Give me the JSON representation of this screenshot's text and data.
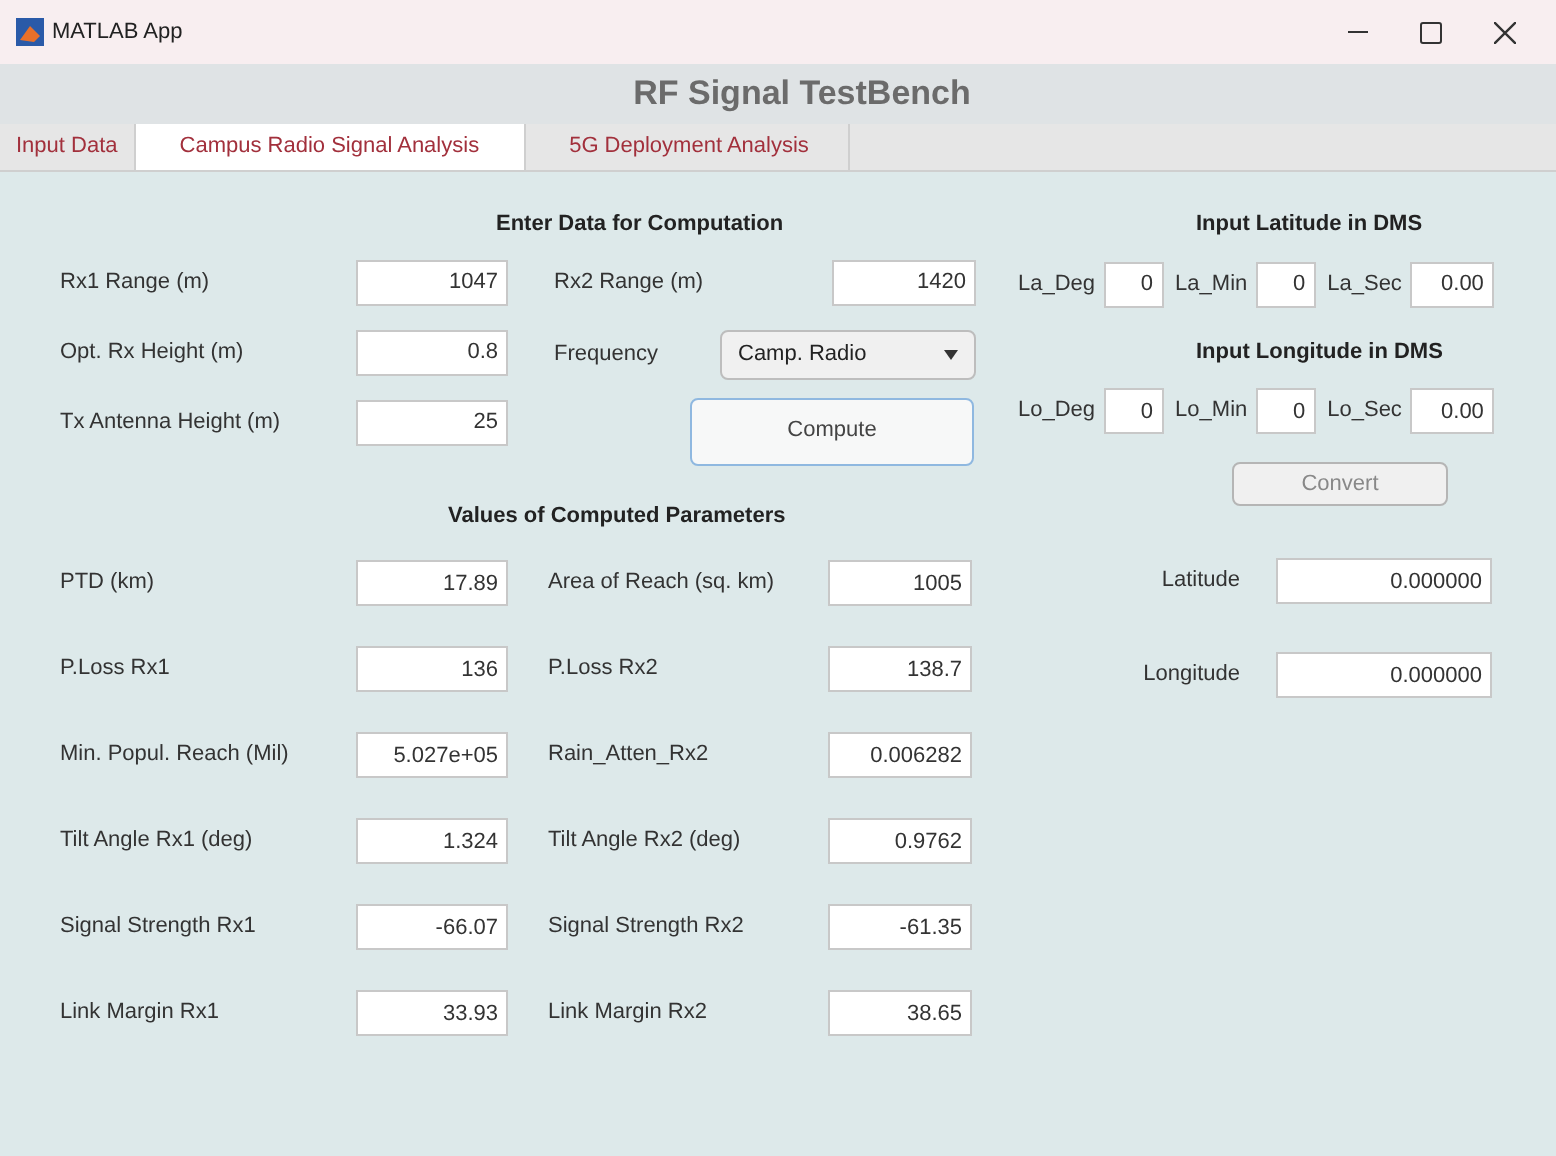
{
  "window": {
    "title": "MATLAB App"
  },
  "header": {
    "title": "RF Signal TestBench"
  },
  "tabs": [
    {
      "label": "Input Data",
      "selected": false
    },
    {
      "label": "Campus Radio Signal Analysis",
      "selected": true
    },
    {
      "label": "5G Deployment Analysis",
      "selected": false
    }
  ],
  "enter_data": {
    "title": "Enter Data for Computation",
    "left_fields": [
      {
        "label": "Rx1 Range (m)",
        "value": "1047"
      },
      {
        "label": "Opt. Rx Height (m)",
        "value": "0.8"
      },
      {
        "label": "Tx Antenna Height (m)",
        "value": "25"
      }
    ],
    "rx2_range": {
      "label": "Rx2 Range (m)",
      "value": "1420"
    },
    "frequency": {
      "label": "Frequency",
      "value": "Camp. Radio"
    },
    "compute_button": "Compute"
  },
  "computed": {
    "title": "Values of Computed Parameters",
    "rows": [
      {
        "left": {
          "label": "PTD (km)",
          "value": "17.89"
        },
        "right": {
          "label": "Area of Reach (sq. km)",
          "value": "1005"
        }
      },
      {
        "left": {
          "label": "P.Loss Rx1",
          "value": "136"
        },
        "right": {
          "label": "P.Loss Rx2",
          "value": "138.7"
        }
      },
      {
        "left": {
          "label": "Min. Popul. Reach (Mil)",
          "value": "5.027e+05"
        },
        "right": {
          "label": "Rain_Atten_Rx2",
          "value": "0.006282"
        }
      },
      {
        "left": {
          "label": "Tilt Angle Rx1 (deg)",
          "value": "1.324"
        },
        "right": {
          "label": "Tilt Angle Rx2 (deg)",
          "value": "0.9762"
        }
      },
      {
        "left": {
          "label": "Signal Strength Rx1",
          "value": "-66.07"
        },
        "right": {
          "label": "Signal Strength Rx2",
          "value": "-61.35"
        }
      },
      {
        "left": {
          "label": "Link Margin Rx1",
          "value": "33.93"
        },
        "right": {
          "label": "Link Margin Rx2",
          "value": "38.65"
        }
      }
    ]
  },
  "dms": {
    "latitude": {
      "title": "Input Latitude in DMS",
      "fields": [
        {
          "label": "La_Deg",
          "value": "0"
        },
        {
          "label": "La_Min",
          "value": "0"
        },
        {
          "label": "La_Sec",
          "value": "0.00"
        }
      ]
    },
    "longitude": {
      "title": "Input Longitude in DMS",
      "fields": [
        {
          "label": "Lo_Deg",
          "value": "0"
        },
        {
          "label": "Lo_Min",
          "value": "0"
        },
        {
          "label": "Lo_Sec",
          "value": "0.00"
        }
      ]
    },
    "convert_button": "Convert",
    "outputs": [
      {
        "label": "Latitude",
        "value": "0.000000"
      },
      {
        "label": "Longitude",
        "value": "0.000000"
      }
    ]
  }
}
